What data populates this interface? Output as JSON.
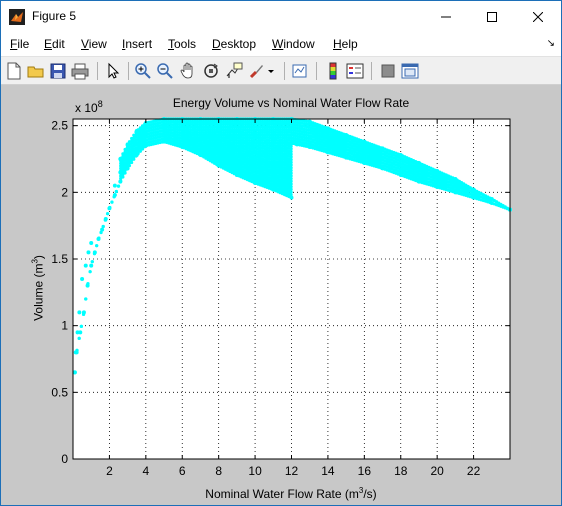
{
  "window": {
    "title": "Figure 5",
    "minimize_icon": "minimize-icon",
    "maximize_icon": "maximize-icon",
    "close_icon": "close-icon"
  },
  "menu": {
    "items": [
      {
        "label": "File",
        "u": "F",
        "rest": "ile"
      },
      {
        "label": "Edit",
        "u": "E",
        "rest": "dit"
      },
      {
        "label": "View",
        "u": "V",
        "rest": "iew"
      },
      {
        "label": "Insert",
        "u": "I",
        "rest": "nsert"
      },
      {
        "label": "Tools",
        "u": "T",
        "rest": "ools"
      },
      {
        "label": "Desktop",
        "u": "D",
        "rest": "esktop"
      },
      {
        "label": "Window",
        "u": "W",
        "rest": "indow"
      },
      {
        "label": "Help",
        "u": "H",
        "rest": "elp"
      }
    ]
  },
  "toolbar": {
    "buttons": [
      "new-figure-icon",
      "open-file-icon",
      "save-icon",
      "print-icon",
      "edit-plot-arrow-icon",
      "zoom-in-icon",
      "zoom-out-icon",
      "pan-hand-icon",
      "rotate-3d-icon",
      "data-cursor-icon",
      "brush-icon",
      "link-plot-icon",
      "colorbar-icon",
      "legend-icon",
      "hide-plot-tools-icon",
      "show-plot-tools-icon"
    ]
  },
  "chart_data": {
    "type": "scatter",
    "title": "Energy Volume vs Nominal Water Flow Rate",
    "xlabel": "Nominal Water Flow Rate (m³/s)",
    "ylabel": "Volume (m³)",
    "y_exponent_label": "x 10",
    "y_exponent_power": "8",
    "xlim": [
      0,
      24
    ],
    "ylim": [
      0,
      2.55
    ],
    "x_ticks": [
      2,
      4,
      6,
      8,
      10,
      12,
      14,
      16,
      18,
      20,
      22
    ],
    "y_ticks": [
      0,
      0.5,
      1,
      1.5,
      2,
      2.5
    ],
    "y_tick_labels": [
      "0",
      "0.5",
      "1",
      "1.5",
      "2",
      "2.5"
    ],
    "grid": true,
    "color": "#00ffff",
    "series": [
      {
        "x": [
          0.1,
          0.2,
          0.4,
          0.6,
          0.8,
          1.0,
          1.2,
          1.4,
          1.6,
          1.8,
          2.0,
          2.3,
          2.6,
          3.0,
          3.5,
          4.0,
          5.0,
          6.0,
          7.0,
          8.0,
          9.0,
          10.0,
          11.0,
          12.0
        ],
        "y": [
          0.65,
          0.8,
          0.95,
          1.1,
          1.3,
          1.45,
          1.55,
          1.65,
          1.72,
          1.8,
          1.88,
          1.98,
          2.08,
          2.18,
          2.28,
          2.35,
          2.38,
          2.34,
          2.28,
          2.2,
          2.13,
          2.07,
          2.02,
          1.96
        ]
      },
      {
        "x": [
          2.3,
          2.6,
          3.0,
          3.5,
          4.0,
          5.0,
          6.0,
          7.0,
          8.0,
          9.0,
          10.0,
          11.0,
          12.0,
          12.3,
          13.0,
          14.0,
          15.0,
          16.0,
          17.0,
          18.0,
          19.0,
          20.0,
          21.0,
          22.0,
          23.0,
          24.0
        ],
        "y": [
          2.05,
          2.15,
          2.26,
          2.36,
          2.44,
          2.5,
          2.52,
          2.51,
          2.49,
          2.46,
          2.43,
          2.4,
          2.37,
          2.36,
          2.34,
          2.3,
          2.26,
          2.22,
          2.18,
          2.13,
          2.08,
          2.04,
          2.0,
          1.96,
          1.92,
          1.87
        ]
      },
      {
        "x": [
          2.6,
          3.0,
          3.5,
          4.0,
          5.0,
          6.0,
          7.0,
          8.0,
          9.0,
          10.0,
          11.0,
          12.0,
          13.0,
          14.0,
          15.0,
          16.0,
          17.0,
          18.0,
          19.0,
          20.0,
          21.0,
          22.0,
          23.0,
          24.0
        ],
        "y": [
          2.25,
          2.36,
          2.46,
          2.52,
          2.55,
          2.55,
          2.55,
          2.55,
          2.55,
          2.55,
          2.55,
          2.55,
          2.53,
          2.48,
          2.43,
          2.38,
          2.33,
          2.28,
          2.22,
          2.16,
          2.1,
          2.02,
          1.95,
          1.87
        ]
      }
    ]
  }
}
